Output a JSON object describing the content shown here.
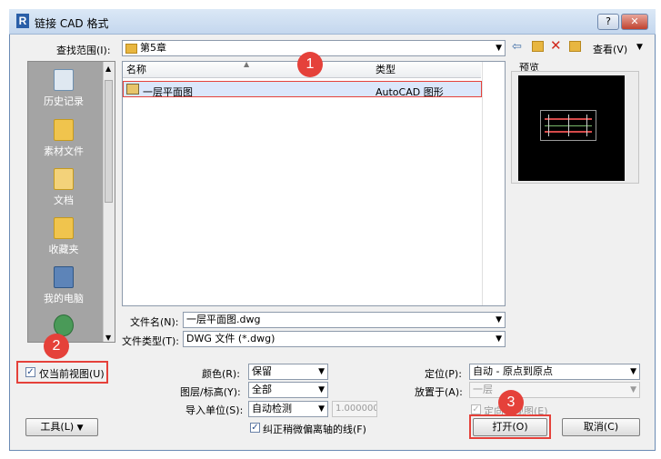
{
  "window": {
    "logo": "R",
    "title": "链接 CAD 格式",
    "help": "?",
    "close": "✕"
  },
  "lookin": {
    "label": "查找范围(I):",
    "value": "第5章",
    "views_label": "查看(V)"
  },
  "places": [
    {
      "label": "历史记录",
      "icon": "history-icon"
    },
    {
      "label": "素材文件",
      "icon": "folder-icon"
    },
    {
      "label": "文档",
      "icon": "documents-icon"
    },
    {
      "label": "收藏夹",
      "icon": "favorites-icon"
    },
    {
      "label": "我的电脑",
      "icon": "computer-icon"
    },
    {
      "label": "",
      "icon": "network-icon"
    }
  ],
  "filelist": {
    "columns": [
      "名称",
      "类型"
    ],
    "rows": [
      {
        "name": "一层平面图",
        "type": "AutoCAD 图形"
      }
    ]
  },
  "preview": {
    "label": "预览"
  },
  "filename": {
    "label": "文件名(N):",
    "value": "一层平面图.dwg"
  },
  "filetype": {
    "label": "文件类型(T):",
    "value": "DWG 文件 (*.dwg)"
  },
  "options": {
    "current_view_only": "仅当前视图(U)",
    "color_label": "颜色(R):",
    "color_value": "保留",
    "layers_label": "图层/标高(Y):",
    "layers_value": "全部",
    "units_label": "导入单位(S):",
    "units_value": "自动检测",
    "units_number": "1.000000",
    "correct_lines": "纠正稍微偏离轴的线(F)",
    "positioning_label": "定位(P):",
    "positioning_value": "自动 - 原点到原点",
    "place_at_label": "放置于(A):",
    "place_at_value": "一层",
    "orient_label": "定向到视图(E)"
  },
  "buttons": {
    "tools": "工具(L)",
    "open": "打开(O)",
    "cancel": "取消(C)"
  },
  "callouts": [
    "1",
    "2",
    "3"
  ],
  "colors": {
    "callout": "#e5413a",
    "selection": "#dbe7fb",
    "title_bar": "#c4d7ee"
  }
}
